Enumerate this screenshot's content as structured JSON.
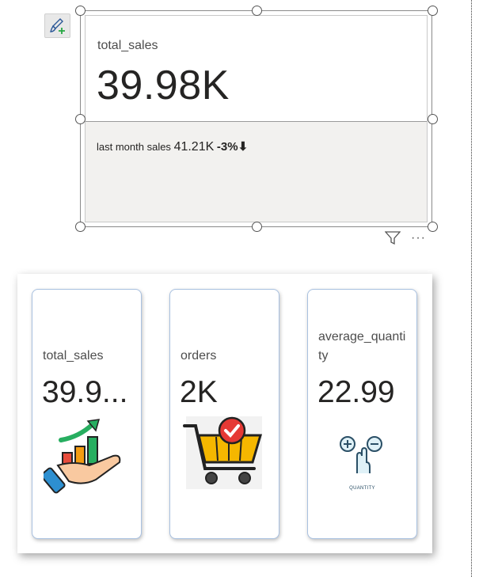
{
  "kpi": {
    "title": "total_sales",
    "value": "39.98K",
    "trend_label": "last month sales",
    "trend_goal": "41.21K",
    "trend_delta": "-3%⬇"
  },
  "cards": [
    {
      "title": "total_sales",
      "value": "39.9...",
      "icon": "sales-growth-hand-icon"
    },
    {
      "title": "orders",
      "value": "2K",
      "icon": "shopping-cart-check-icon"
    },
    {
      "title_line1": "average_quanti",
      "title_line2": "ty",
      "value": "22.99",
      "icon": "quantity-plus-minus-icon",
      "icon_caption": "QUANTITY"
    }
  ],
  "colors": {
    "bar_green": "#27ae60",
    "bar_orange": "#f39c12",
    "bar_red": "#e74c3c",
    "cart_yellow": "#f5b700",
    "check_red": "#e53935",
    "hand_blue": "#2d8fd0"
  }
}
